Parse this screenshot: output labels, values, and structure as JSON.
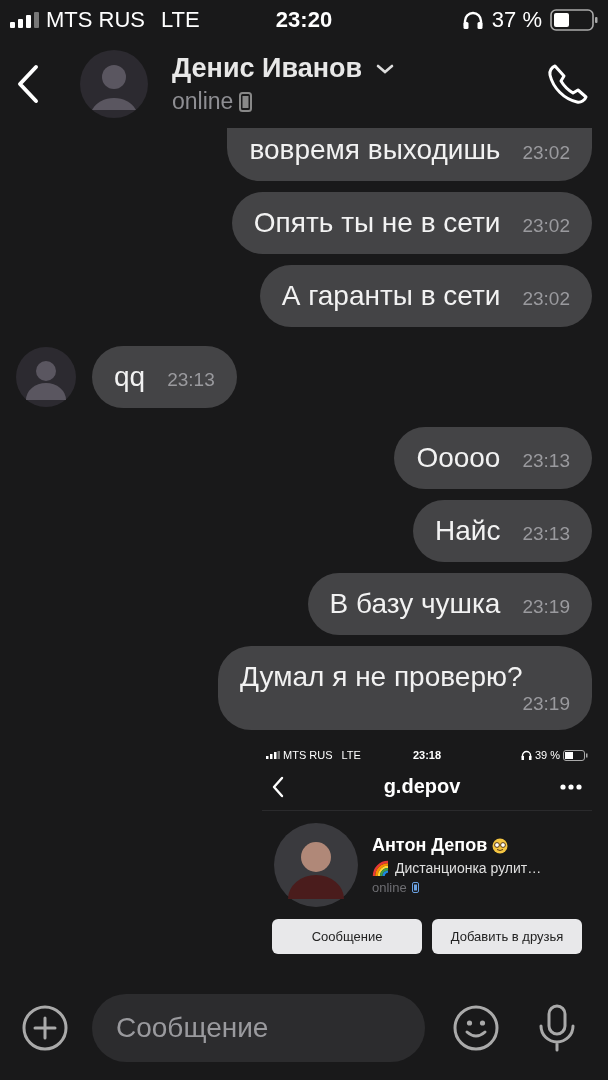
{
  "status_bar": {
    "carrier": "MTS RUS",
    "network": "LTE",
    "time": "23:20",
    "battery": "37 %"
  },
  "header": {
    "name": "Денис Иванов",
    "status": "online"
  },
  "messages": [
    {
      "kind": "out",
      "text": "вовремя выходишь",
      "time": "23:02"
    },
    {
      "kind": "out",
      "text": "Опять ты не в сети",
      "time": "23:02"
    },
    {
      "kind": "out",
      "text": "А гаранты в сети",
      "time": "23:02"
    },
    {
      "kind": "in",
      "text": "qq",
      "time": "23:13"
    },
    {
      "kind": "out",
      "text": "Ооооо",
      "time": "23:13"
    },
    {
      "kind": "out",
      "text": "Найс",
      "time": "23:13"
    },
    {
      "kind": "out",
      "text": "В базу чушка",
      "time": "23:19"
    },
    {
      "kind": "out",
      "text": "Думал я не проверю?",
      "time": "23:19"
    }
  ],
  "attachment": {
    "kind": "screenshot",
    "status_bar": {
      "carrier": "MTS RUS",
      "network": "LTE",
      "time": "23:18",
      "battery": "39 %"
    },
    "title": "g.depov",
    "profile": {
      "name": "Антон Депов",
      "status_text": "Дистанционка рулит…",
      "presence": "online"
    },
    "buttons": [
      "Сообщение",
      "Добавить в друзья"
    ]
  },
  "composer": {
    "placeholder": "Сообщение"
  }
}
